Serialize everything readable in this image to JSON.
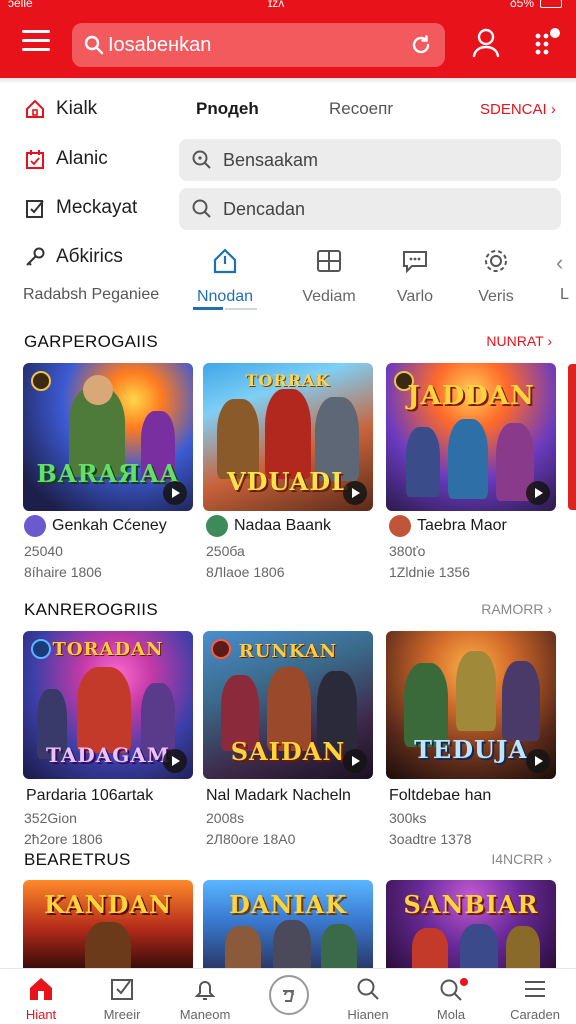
{
  "status": {
    "left": "ɔelle",
    "mid": "ɪzʌ",
    "right": "δ5%"
  },
  "header": {
    "search_text": "Iosabeнkan"
  },
  "side_menu": [
    {
      "label": "Kialk",
      "icon": "house-icon"
    },
    {
      "label": "Alanic",
      "icon": "calendar-icon"
    },
    {
      "label": "Meckayat",
      "icon": "checklist-icon"
    },
    {
      "label": "Aбkirics",
      "icon": "key-icon"
    }
  ],
  "top_tabs": {
    "active": "Pnoдeh",
    "second": "Recoeпr",
    "link": "SDENCAI"
  },
  "fields": [
    {
      "text": "Bensaakam"
    },
    {
      "text": "Dencadan"
    }
  ],
  "side_label": "Radabsh Peganiee",
  "categories": [
    {
      "label": "Nnodan",
      "icon": "home-icon",
      "active": true
    },
    {
      "label": "Vediam",
      "icon": "grid-panel-icon"
    },
    {
      "label": "Varlo",
      "icon": "chat-icon"
    },
    {
      "label": "Veris",
      "icon": "gear-icon"
    },
    {
      "label": "L",
      "icon": "chevron-left-icon"
    }
  ],
  "sections": [
    {
      "title": "GARPEROGAIIS",
      "more": "NUNRAT",
      "cards": [
        {
          "art": "BARAЯAA",
          "name": "Genkah Cćeney",
          "meta1": "25040",
          "meta2": "8íhaire 1806"
        },
        {
          "art": "VDUADL",
          "name": "Nadaa Baank",
          "meta1": "250ба",
          "meta2": "8Лlaoe 1806"
        },
        {
          "art": "JADDAN",
          "name": "Taebra Maor",
          "meta1": "380ťo",
          "meta2": "1Zldnie 1356"
        }
      ]
    },
    {
      "title": "KANREROGRIIS",
      "more": "RAMORR",
      "cards": [
        {
          "art": "TORADAN",
          "name": "Pardaria 106artak",
          "meta1": "352Gion",
          "meta2": "2ћ2ore 1806"
        },
        {
          "art": "SAIDAN",
          "name": "Nal Madark Nacheln",
          "meta1": "2008s",
          "meta2": "2Л80ore 18A0"
        },
        {
          "art": "TEDUJA",
          "name": "Foltdebae han",
          "meta1": "300ks",
          "meta2": "3oadtre 1378"
        }
      ]
    },
    {
      "title": "BEARETRUS",
      "more": "I4NCRR",
      "cards": [
        {
          "art": "KANDAN"
        },
        {
          "art": "DANIAK"
        },
        {
          "art": "SANBIAR"
        }
      ]
    }
  ],
  "bottom_nav": [
    {
      "label": "Hiant",
      "icon": "home-icon",
      "active": true
    },
    {
      "label": "Mreeir",
      "icon": "checkbox-icon"
    },
    {
      "label": "Maneom",
      "icon": "bell-icon"
    },
    {
      "label": "",
      "icon": "circle-action-icon"
    },
    {
      "label": "Hianen",
      "icon": "search-icon"
    },
    {
      "label": "Mola",
      "icon": "search-badge-icon"
    },
    {
      "label": "Caraden",
      "icon": "menu-lines-icon"
    }
  ],
  "colors": {
    "brand": "#e8121b",
    "accent_blue": "#1f6fb2"
  }
}
